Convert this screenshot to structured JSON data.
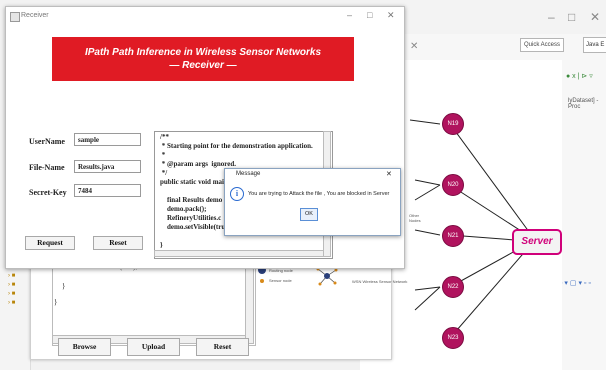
{
  "ide": {
    "quick_access": "Quick Access",
    "tab_label": "Java E",
    "dataset_text": "lyDataset] - Proc",
    "minimize_glyph": "–",
    "maximize_glyph": "□",
    "close_glyph": "✕",
    "controls2": "– □",
    "icons_row": "● x | ⊳ ▿",
    "icons_row2": "▪ ▾ ▢ ▾ ▫ ▫"
  },
  "network": {
    "nodes": [
      "N19",
      "N20",
      "N21",
      "N22",
      "N23"
    ],
    "server_label": "Server",
    "other_nodes_label": "Other Nodes",
    "legend_routing": "Routing node",
    "legend_sensor": "Sensor node",
    "legend_network": "WSN Wireless Sensor Network"
  },
  "middle": {
    "close_glyph": "✕",
    "code_lines": [
      "Receiver.setVisible(true);",
      "}",
      "}"
    ],
    "buttons": {
      "browse": "Browse",
      "upload": "Upload",
      "reset": "Reset"
    }
  },
  "receiver": {
    "title": "Receiver",
    "banner_line1": "IPath Path Inference in Wireless Sensor Networks",
    "banner_line2": "— Receiver —",
    "labels": {
      "username": "UserName",
      "filename": "File-Name",
      "secretkey": "Secret-Key"
    },
    "values": {
      "username": "sample",
      "filename": "Results.java",
      "secretkey": "7484"
    },
    "code": "/**\n * Starting point for the demonstration application.\n *\n * @param args  ignored.\n */\npublic static void mai\n\n    final Results demo\n    demo.pack();\n    RefineryUtilities.c\n    demo.setVisible(tru...)\n\n}",
    "buttons": {
      "request": "Request",
      "reset": "Reset"
    },
    "minimize_glyph": "–",
    "maximize_glyph": "□",
    "close_glyph": "✕"
  },
  "dialog": {
    "title": "Message",
    "message": "You are trying to Attack the file , You are blocked in Server",
    "ok": "OK",
    "close_glyph": "✕",
    "icon_glyph": "i"
  }
}
